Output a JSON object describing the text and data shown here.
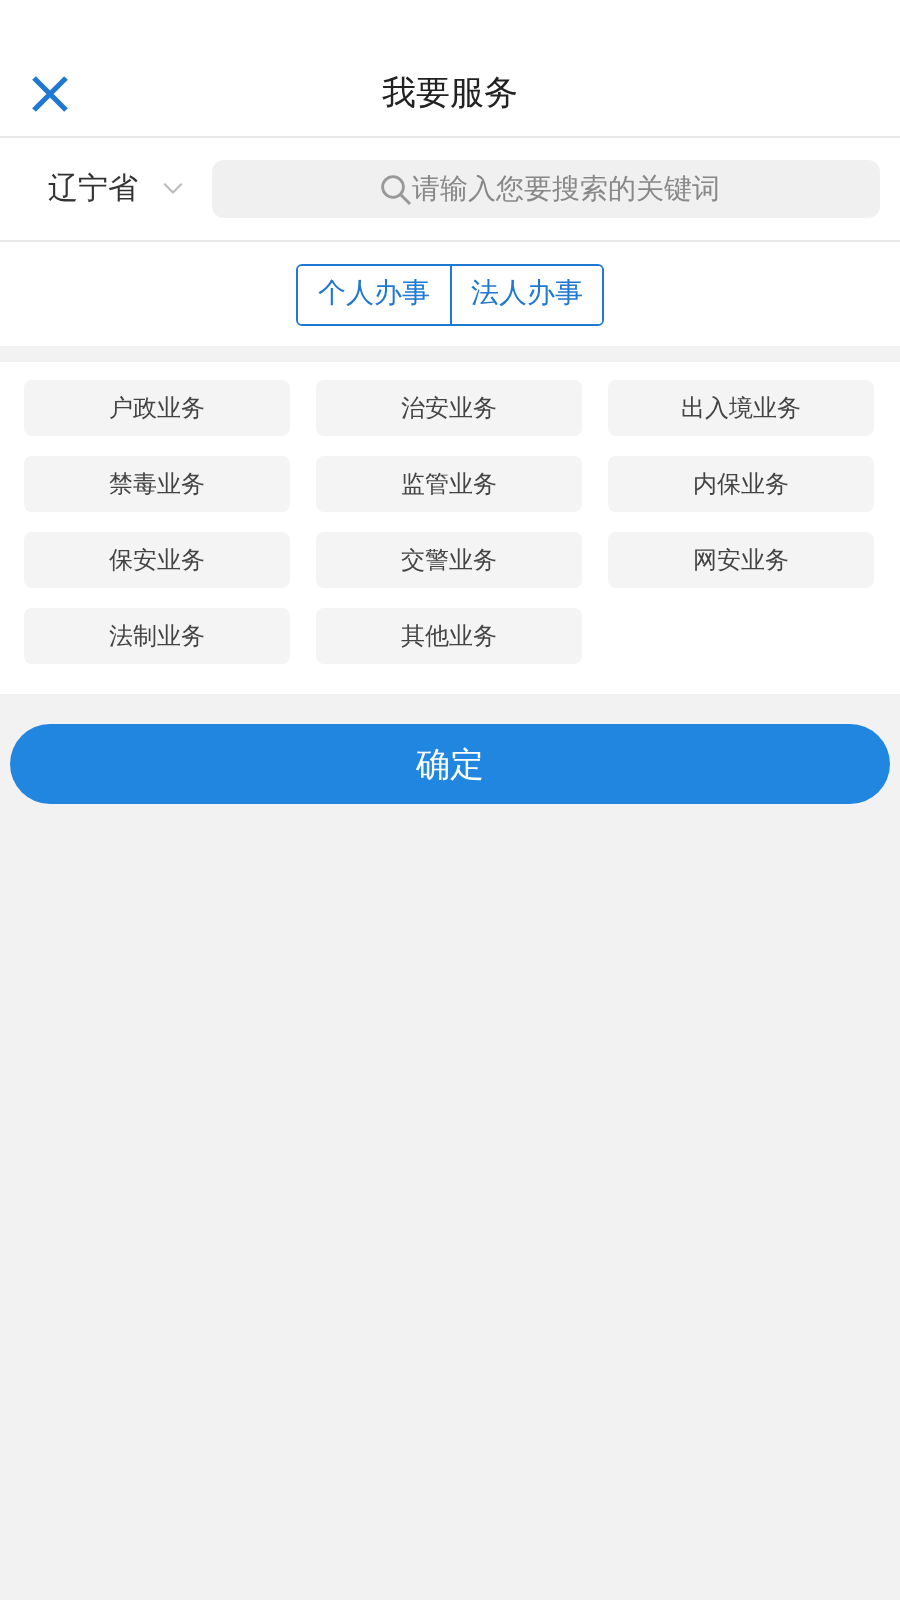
{
  "header": {
    "title": "我要服务"
  },
  "region": {
    "value": "辽宁省"
  },
  "search": {
    "placeholder": "请输入您要搜索的关键词"
  },
  "tabs": [
    {
      "label": "个人办事",
      "selected": false
    },
    {
      "label": "法人办事",
      "selected": false
    }
  ],
  "services": [
    {
      "label": "户政业务",
      "selected": false
    },
    {
      "label": "治安业务",
      "selected": false
    },
    {
      "label": "出入境业务",
      "selected": false
    },
    {
      "label": "禁毒业务",
      "selected": false
    },
    {
      "label": "监管业务",
      "selected": false
    },
    {
      "label": "内保业务",
      "selected": false
    },
    {
      "label": "保安业务",
      "selected": false
    },
    {
      "label": "交警业务",
      "selected": false
    },
    {
      "label": "网安业务",
      "selected": false
    },
    {
      "label": "法制业务",
      "selected": false
    },
    {
      "label": "其他业务",
      "selected": false
    }
  ],
  "confirm_button": {
    "label": "确定"
  }
}
